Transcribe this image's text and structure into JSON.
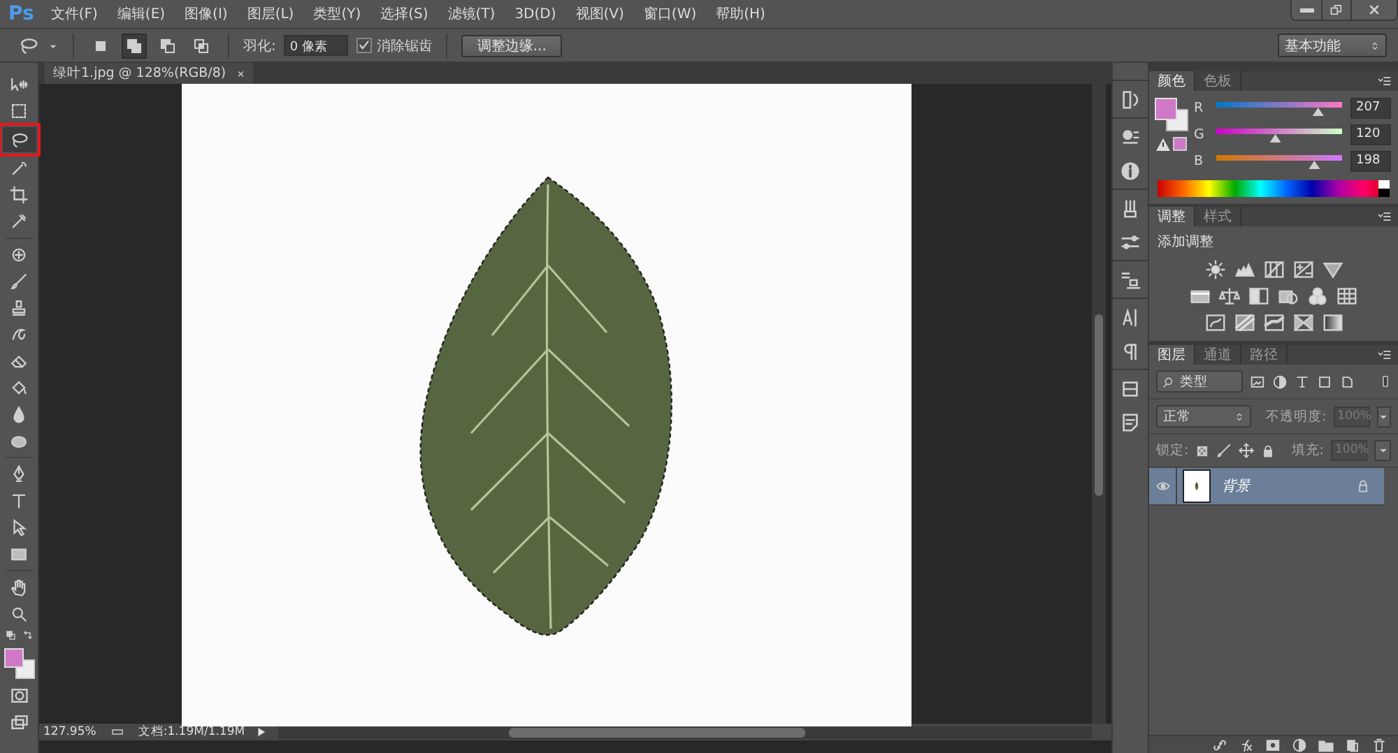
{
  "menu_bar": {
    "logo": "Ps",
    "items": [
      "文件(F)",
      "编辑(E)",
      "图像(I)",
      "图层(L)",
      "类型(Y)",
      "选择(S)",
      "滤镜(T)",
      "3D(D)",
      "视图(V)",
      "窗口(W)",
      "帮助(H)"
    ]
  },
  "options_bar": {
    "selection_modes": [
      {
        "selected": false
      },
      {
        "selected": true
      },
      {
        "selected": false
      },
      {
        "selected": false
      }
    ],
    "feather_label": "羽化:",
    "feather_value": "0 像素",
    "antialias": {
      "label": "消除锯齿",
      "checked": true
    },
    "refine_edge_button": "调整边缘...",
    "workspace": "基本功能"
  },
  "toolbar": {
    "tools": [
      {
        "selected": false
      },
      {
        "selected": false
      },
      {
        "selected": true
      },
      {
        "selected": false
      },
      {
        "selected": false
      },
      {
        "selected": false
      },
      {
        "selected": false
      },
      {
        "selected": false
      },
      {
        "selected": false
      },
      {
        "selected": false
      },
      {
        "selected": false
      },
      {
        "selected": false
      },
      {
        "selected": false
      },
      {
        "selected": false
      },
      {
        "selected": false
      },
      {
        "selected": false
      },
      {
        "selected": false
      },
      {
        "selected": false
      },
      {
        "selected": false
      },
      {
        "selected": false
      }
    ]
  },
  "document": {
    "tab_title": "绿叶1.jpg @ 128%(RGB/8)",
    "close": "×",
    "zoom": "127.95%",
    "doc_size": "文档:1.19M/1.19M"
  },
  "color_panel": {
    "tabs": [
      {
        "label": "颜色",
        "selected": true
      },
      {
        "label": "色板",
        "selected": false
      }
    ],
    "channels": [
      {
        "name": "R",
        "level": 0.81,
        "value": "207"
      },
      {
        "name": "G",
        "level": 0.47,
        "value": "120"
      },
      {
        "name": "B",
        "level": 0.78,
        "value": "198"
      }
    ]
  },
  "adjustments_panel": {
    "tabs": [
      {
        "label": "调整",
        "selected": true
      },
      {
        "label": "样式",
        "selected": false
      }
    ],
    "heading": "添加调整"
  },
  "layers_panel": {
    "tabs": [
      {
        "label": "图层",
        "selected": true
      },
      {
        "label": "通道",
        "selected": false
      },
      {
        "label": "路径",
        "selected": false
      }
    ],
    "filter": "类型",
    "blend_mode": "正常",
    "opacity_label": "不透明度:",
    "opacity": "100%",
    "lock_label": "锁定:",
    "fill_label": "填充:",
    "fill": "100%",
    "layers": [
      {
        "name": "背景",
        "visible": true,
        "locked": true,
        "selected": true
      }
    ]
  }
}
